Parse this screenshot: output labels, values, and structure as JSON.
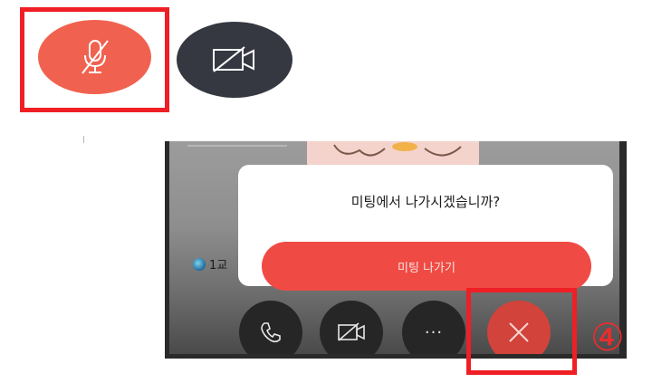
{
  "top_toolbar": {
    "mic_button_icon": "mic-off-icon",
    "camera_button_icon": "video-off-icon",
    "mic_color": "#f0624f",
    "camera_color": "#353841"
  },
  "dialog": {
    "message": "미팅에서 나가시겠습니까?",
    "leave_label": "미팅 나가기"
  },
  "participant": {
    "label": "1교"
  },
  "bottom_controls": [
    {
      "icon": "phone-icon"
    },
    {
      "icon": "video-off-icon"
    },
    {
      "icon": "more-icon",
      "label": "···"
    },
    {
      "icon": "close-icon"
    }
  ],
  "annotation": {
    "step": "④",
    "color": "#ef1f25"
  }
}
